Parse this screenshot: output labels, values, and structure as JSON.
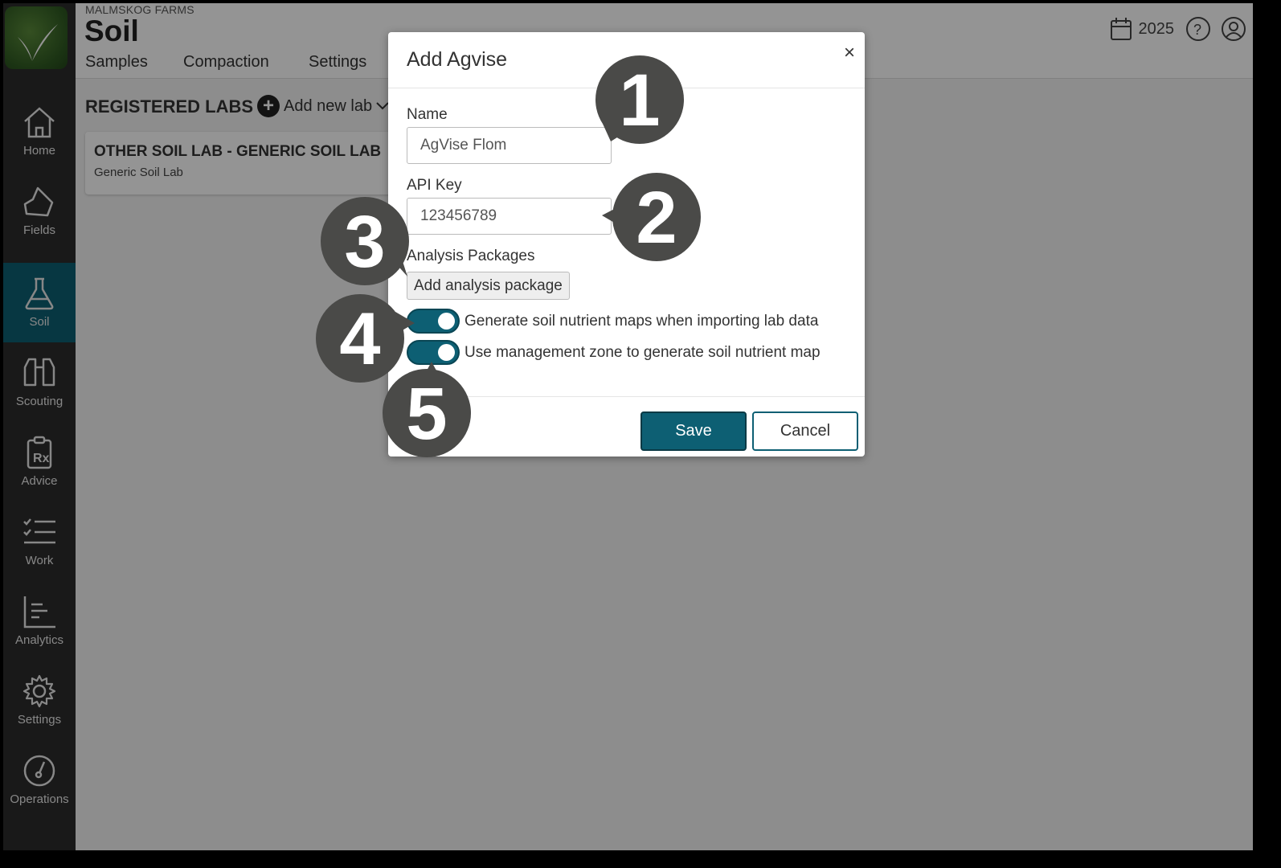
{
  "header": {
    "farm_name": "MALMSKOG FARMS",
    "title": "Soil",
    "tabs": [
      "Samples",
      "Compaction",
      "Settings"
    ],
    "year": "2025"
  },
  "sidebar": {
    "items": [
      {
        "label": "Home",
        "icon": "home-icon"
      },
      {
        "label": "Fields",
        "icon": "field-icon"
      },
      {
        "label": "Soil",
        "icon": "flask-icon",
        "active": true
      },
      {
        "label": "Scouting",
        "icon": "binoculars-icon"
      },
      {
        "label": "Advice",
        "icon": "prescription-icon"
      },
      {
        "label": "Work",
        "icon": "checklist-icon"
      },
      {
        "label": "Analytics",
        "icon": "bar-chart-icon"
      },
      {
        "label": "Settings",
        "icon": "gear-icon"
      },
      {
        "label": "Operations",
        "icon": "gauge-icon"
      }
    ]
  },
  "content": {
    "section_title": "REGISTERED LABS",
    "add_lab_label": "Add new lab",
    "lab_card": {
      "name": "OTHER SOIL LAB - GENERIC SOIL LAB",
      "subtitle": "Generic Soil Lab"
    }
  },
  "modal": {
    "title": "Add Agvise",
    "close": "×",
    "name_label": "Name",
    "name_value": "AgVise Flom",
    "api_key_label": "API Key",
    "api_key_value": "123456789",
    "packages_label": "Analysis Packages",
    "add_package_label": "Add analysis package",
    "toggle1_label": "Generate soil nutrient maps when importing lab data",
    "toggle1_on": true,
    "toggle2_label": "Use management zone to generate soil nutrient map",
    "toggle2_on": true,
    "save_label": "Save",
    "cancel_label": "Cancel"
  },
  "callouts": [
    "1",
    "2",
    "3",
    "4",
    "5"
  ],
  "colors": {
    "sidebar_bg": "#2b2b2b",
    "accent": "#0d5f73",
    "callout": "#4a4a48"
  }
}
